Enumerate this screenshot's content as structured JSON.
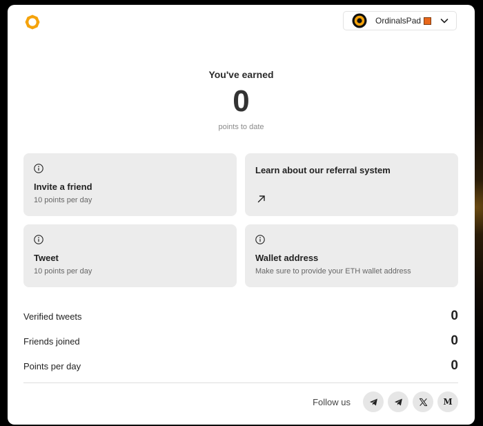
{
  "colors": {
    "accent": "#f5a30b",
    "card_bg": "#ececec",
    "account_badge": "#e8671b"
  },
  "header": {
    "logo_icon": "ring-logo-icon",
    "account": {
      "name": "OrdinalsPad",
      "avatar_icon": "ordinals-avatar-icon",
      "dropdown_icon": "chevron-down-icon"
    }
  },
  "earned": {
    "title": "You've earned",
    "value": "0",
    "caption": "points to date"
  },
  "cards": {
    "invite": {
      "icon": "info-icon",
      "title": "Invite a friend",
      "subtitle": "10 points per day"
    },
    "referral": {
      "title": "Learn about our referral system",
      "icon": "arrow-up-right-icon"
    },
    "tweet": {
      "icon": "info-icon",
      "title": "Tweet",
      "subtitle": "10 points per day"
    },
    "wallet": {
      "icon": "info-icon",
      "title": "Wallet address",
      "subtitle": "Make sure to provide your ETH wallet address"
    }
  },
  "stats": [
    {
      "label": "Verified tweets",
      "value": "0"
    },
    {
      "label": "Friends joined",
      "value": "0"
    },
    {
      "label": "Points per day",
      "value": "0"
    }
  ],
  "footer": {
    "follow_label": "Follow us",
    "socials": [
      {
        "icon": "telegram-icon"
      },
      {
        "icon": "telegram-icon"
      },
      {
        "icon": "x-icon"
      },
      {
        "icon": "medium-icon",
        "glyph": "M"
      }
    ]
  }
}
